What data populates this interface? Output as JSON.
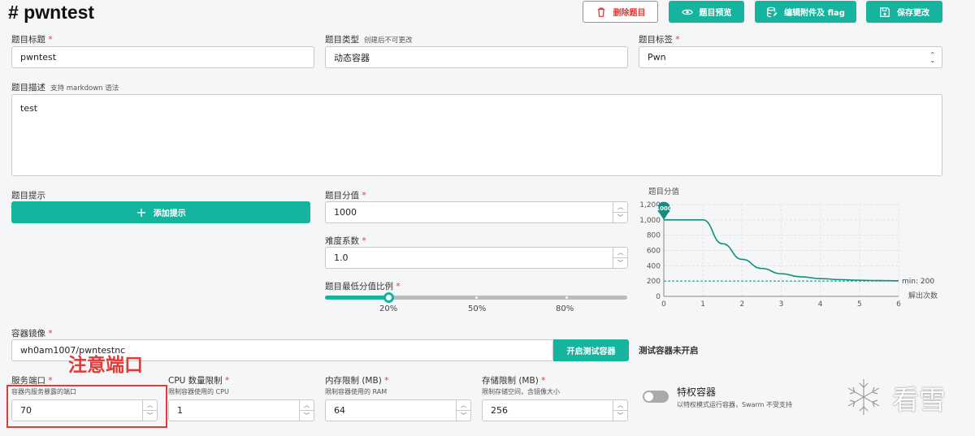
{
  "page": {
    "title": "# pwntest"
  },
  "toolbar": {
    "delete_label": "删除题目",
    "preview_label": "题目预览",
    "edit_attach_label": "编辑附件及 flag",
    "save_label": "保存更改"
  },
  "form": {
    "title": {
      "label": "题目标题",
      "value": "pwntest"
    },
    "type": {
      "label": "题目类型",
      "note": "创建后不可更改",
      "value": "动态容器"
    },
    "tag": {
      "label": "题目标签",
      "value": "Pwn"
    },
    "description": {
      "label": "题目描述",
      "note": "支持 markdown 语法",
      "value": "test"
    },
    "hints": {
      "label": "题目提示",
      "add_label": "添加提示"
    },
    "score": {
      "label": "题目分值",
      "value": "1000"
    },
    "difficulty": {
      "label": "难度系数",
      "value": "1.0"
    },
    "min_ratio": {
      "label": "题目最低分值比例",
      "value": 0.2,
      "ticks": [
        "20%",
        "50%",
        "80%"
      ]
    },
    "image": {
      "label": "容器镜像",
      "value": "wh0am1007/pwntestnc",
      "test_button": "开启测试容器",
      "status": "测试容器未开启"
    },
    "port": {
      "label": "服务端口",
      "desc": "容器内服务暴露的端口",
      "value": "70"
    },
    "cpu": {
      "label": "CPU 数量限制",
      "desc": "限制容器使用的 CPU",
      "value": "1"
    },
    "memory": {
      "label": "内存限制 (MB)",
      "desc": "限制容器使用的 RAM",
      "value": "64"
    },
    "storage": {
      "label": "存储限制 (MB)",
      "desc": "限制存储空间，含镜像大小",
      "value": "256"
    },
    "privileged": {
      "label": "特权容器",
      "desc": "以特权模式运行容器，Swarm 不受支持",
      "enabled": false
    }
  },
  "chart_data": {
    "type": "line",
    "title": "题目分值",
    "xlabel": "解出次数",
    "xlim": [
      0,
      6
    ],
    "ylim": [
      0,
      1200
    ],
    "x_ticks": [
      "0",
      "1",
      "2",
      "3",
      "4",
      "5",
      "6"
    ],
    "y_ticks": [
      "0",
      "200",
      "400",
      "600",
      "800",
      "1,000",
      "1,200"
    ],
    "series": [
      {
        "x": [
          0,
          0.5,
          1,
          1.5,
          2,
          2.5,
          3,
          3.5,
          4,
          4.5,
          5,
          5.5,
          6
        ],
        "values": [
          1000,
          1000,
          1000,
          688,
          484,
          365,
          296,
          256,
          232,
          219,
          211,
          206,
          204
        ]
      }
    ],
    "marker": {
      "x": 0,
      "value": 1000,
      "label": "1000"
    },
    "min_line": {
      "value": 200,
      "label": "min: 200"
    },
    "color": "#0f8f7e"
  },
  "annotation": {
    "text": "注意端口"
  },
  "watermark": {
    "text": "看雪"
  },
  "colors": {
    "accent": "#14b49e",
    "danger": "#e53935"
  }
}
